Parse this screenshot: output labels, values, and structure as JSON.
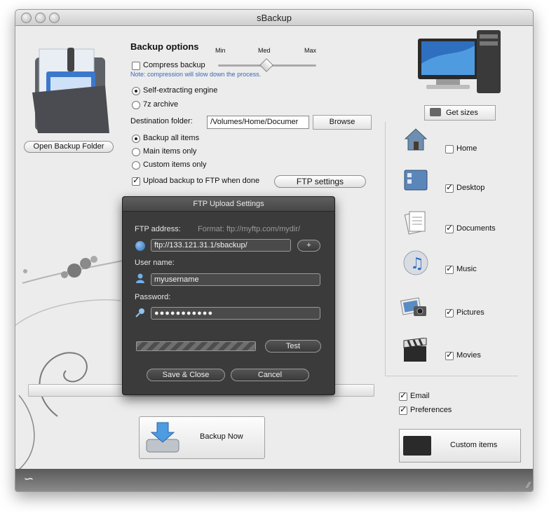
{
  "window": {
    "title": "sBackup"
  },
  "left": {
    "open_backup_folder": "Open Backup Folder"
  },
  "options": {
    "heading": "Backup options",
    "compress_label": "Compress backup",
    "compress_checked": false,
    "slider_min": "Min",
    "slider_med": "Med",
    "slider_max": "Max",
    "slider_value": "Med",
    "note": "Note: compression will slow down the process.",
    "engine": [
      {
        "label": "Self-extracting engine",
        "selected": true
      },
      {
        "label": "7z archive",
        "selected": false
      }
    ],
    "destination_label": "Destination folder:",
    "destination_value": "/Volumes/Home/Documer",
    "browse": "Browse",
    "scope": [
      {
        "label": "Backup all items",
        "selected": true
      },
      {
        "label": "Main items only",
        "selected": false
      },
      {
        "label": "Custom items only",
        "selected": false
      }
    ],
    "ftp_upload_label": "Upload backup to FTP when done",
    "ftp_upload_checked": true,
    "ftp_settings": "FTP settings"
  },
  "right": {
    "get_sizes": "Get sizes",
    "items": [
      {
        "label": "Home",
        "checked": false,
        "icon": "home-icon"
      },
      {
        "label": "Desktop",
        "checked": true,
        "icon": "desktop-icon"
      },
      {
        "label": "Documents",
        "checked": true,
        "icon": "documents-icon"
      },
      {
        "label": "Music",
        "checked": true,
        "icon": "music-icon"
      },
      {
        "label": "Pictures",
        "checked": true,
        "icon": "pictures-icon"
      },
      {
        "label": "Movies",
        "checked": true,
        "icon": "movies-icon"
      }
    ],
    "email_label": "Email",
    "email_checked": true,
    "preferences_label": "Preferences",
    "preferences_checked": true,
    "custom_items": "Custom items"
  },
  "bottom": {
    "backup_now": "Backup Now"
  },
  "dialog": {
    "title": "FTP Upload Settings",
    "ftp_address_label": "FTP address:",
    "format_hint": "Format: ftp://myftp.com/mydir/",
    "ftp_address_value": "ftp://133.121.31.1/sbackup/",
    "add_button": "+",
    "username_label": "User name:",
    "username_value": "myusername",
    "password_label": "Password:",
    "password_value": "●●●●●●●●●●●",
    "test": "Test",
    "save_close": "Save & Close",
    "cancel": "Cancel"
  }
}
